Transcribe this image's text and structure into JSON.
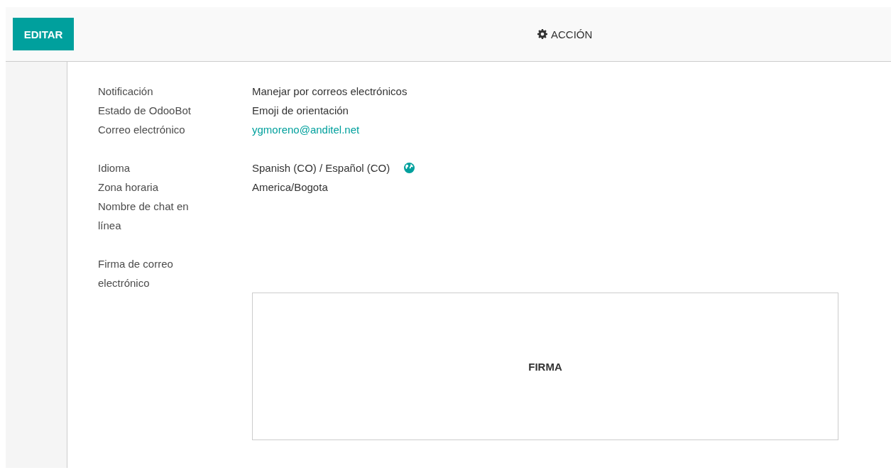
{
  "toolbar": {
    "edit_button": "EDITAR",
    "action_menu": "ACCIÓN"
  },
  "groups": [
    {
      "fields": [
        {
          "label": "Notificación",
          "kind": "text",
          "value": "Manejar por correos electrónicos"
        },
        {
          "label": "Estado de OdooBot",
          "kind": "text",
          "value": "Emoji de orientación"
        },
        {
          "label": "Correo electrónico",
          "kind": "link",
          "value": "ygmoreno@anditel.net"
        }
      ]
    },
    {
      "fields": [
        {
          "label": "Idioma",
          "kind": "language",
          "value": "Spanish (CO) / Español (CO)"
        },
        {
          "label": "Zona horaria",
          "kind": "text",
          "value": "America/Bogota"
        },
        {
          "label": "Nombre de chat en línea",
          "kind": "empty"
        }
      ]
    }
  ],
  "signature": {
    "label": "Firma de correo electrónico",
    "box_text": "FIRMA"
  }
}
